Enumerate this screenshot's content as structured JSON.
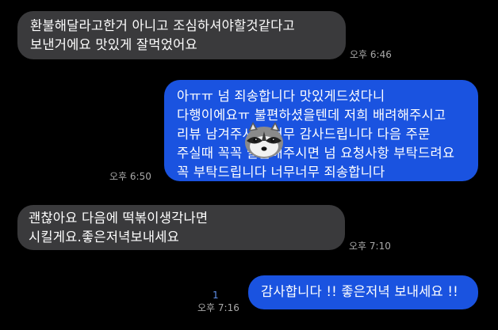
{
  "messages": [
    {
      "direction": "incoming",
      "text": "환불해달라고한거 아니고 조심하셔야할것같다고\n보낸거에요 맛있게 잘먹었어요",
      "time": "오후 6:46"
    },
    {
      "direction": "outgoing",
      "text": "아ㅠㅠ 넘 죄송합니다 맛있게드셨다니\n다행이에요ㅠ 불편하셨을텐데 저희 배려해주시고\n리뷰 남겨주셔서 너무 감사드립니다 다음 주문\n주실때 꼭꼭 말씀해주시면 넘 요청사항 부탁드려요\n꼭 부탁드립니다 너무너무 죄송합니다",
      "time": "오후 6:50",
      "sticker": "raccoon-face-icon"
    },
    {
      "direction": "incoming",
      "text": "괜찮아요 다음에 떡볶이생각나면\n시킬게요.좋은저녁보내세요",
      "time": "오후 7:10"
    },
    {
      "direction": "outgoing",
      "text": "감사합니다 !! 좋은저녁 보내세요 !!",
      "time": "오후 7:16",
      "unread": "1"
    }
  ],
  "colors": {
    "background": "#000000",
    "incoming_bubble": "#3a3a3c",
    "outgoing_bubble": "#1a53e0",
    "timestamp": "#a9a9a9",
    "unread": "#5f8fe8"
  }
}
